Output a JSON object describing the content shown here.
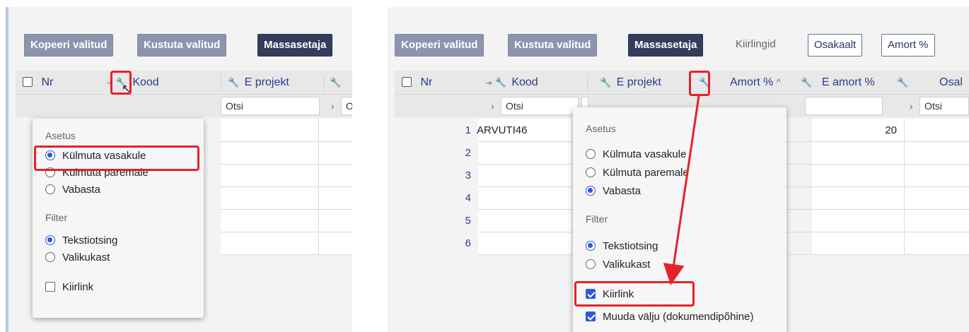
{
  "left": {
    "toolbar": {
      "copy_label": "Kopeeri valitud",
      "delete_label": "Kustuta valitud",
      "mass_label": "Massasetaja"
    },
    "columns": {
      "nr": "Nr",
      "kood": "Kood",
      "e_projekt": "E projekt"
    },
    "filter": {
      "placeholder": "Otsi",
      "placeholder_cut": "O"
    },
    "menu": {
      "section_setting": "Asetus",
      "freeze_left": "Külmuta vasakule",
      "freeze_right": "Külmuta paremale",
      "release": "Vabasta",
      "section_filter": "Filter",
      "text_search": "Tekstiotsing",
      "select_box": "Valikukast",
      "quick_link": "Kiirlink",
      "selected_setting": "freeze_left",
      "selected_filter": "text_search",
      "quick_link_checked": false
    }
  },
  "right": {
    "toolbar": {
      "copy_label": "Kopeeri valitud",
      "delete_label": "Kustuta valitud",
      "mass_label": "Massasetaja",
      "quicklinks_label": "Kiirlingid",
      "osakaalt_label": "Osakaalt",
      "amort_label": "Amort %"
    },
    "columns": {
      "nr": "Nr",
      "kood": "Kood",
      "e_projekt": "E projekt",
      "amort": "Amort %",
      "sort_icon": "^",
      "e_amort": "E amort %",
      "osa_cut": "Osal"
    },
    "filter": {
      "placeholder": "Otsi"
    },
    "rows": [
      {
        "nr": "1",
        "kood": "ARVUTI46",
        "e_amort": "20"
      },
      {
        "nr": "2",
        "kood": "",
        "e_amort": ""
      },
      {
        "nr": "3",
        "kood": "",
        "e_amort": ""
      },
      {
        "nr": "4",
        "kood": "",
        "e_amort": ""
      },
      {
        "nr": "5",
        "kood": "",
        "e_amort": ""
      },
      {
        "nr": "6",
        "kood": "",
        "e_amort": ""
      }
    ],
    "menu": {
      "section_setting": "Asetus",
      "freeze_left": "Külmuta vasakule",
      "freeze_right": "Külmuta paremale",
      "release": "Vabasta",
      "section_filter": "Filter",
      "text_search": "Tekstiotsing",
      "select_box": "Valikukast",
      "quick_link": "Kiirlink",
      "change_fields": "Muuda välju (dokumendipõhine)",
      "selected_setting": "release",
      "selected_filter": "text_search",
      "quick_link_checked": true,
      "change_fields_checked": true
    }
  },
  "colors": {
    "highlight": "#e8202a",
    "radio_accent": "#2d5bd8",
    "header_text": "#2a3b8f",
    "button_gray": "#8d95ae",
    "button_dark": "#343d5c"
  }
}
